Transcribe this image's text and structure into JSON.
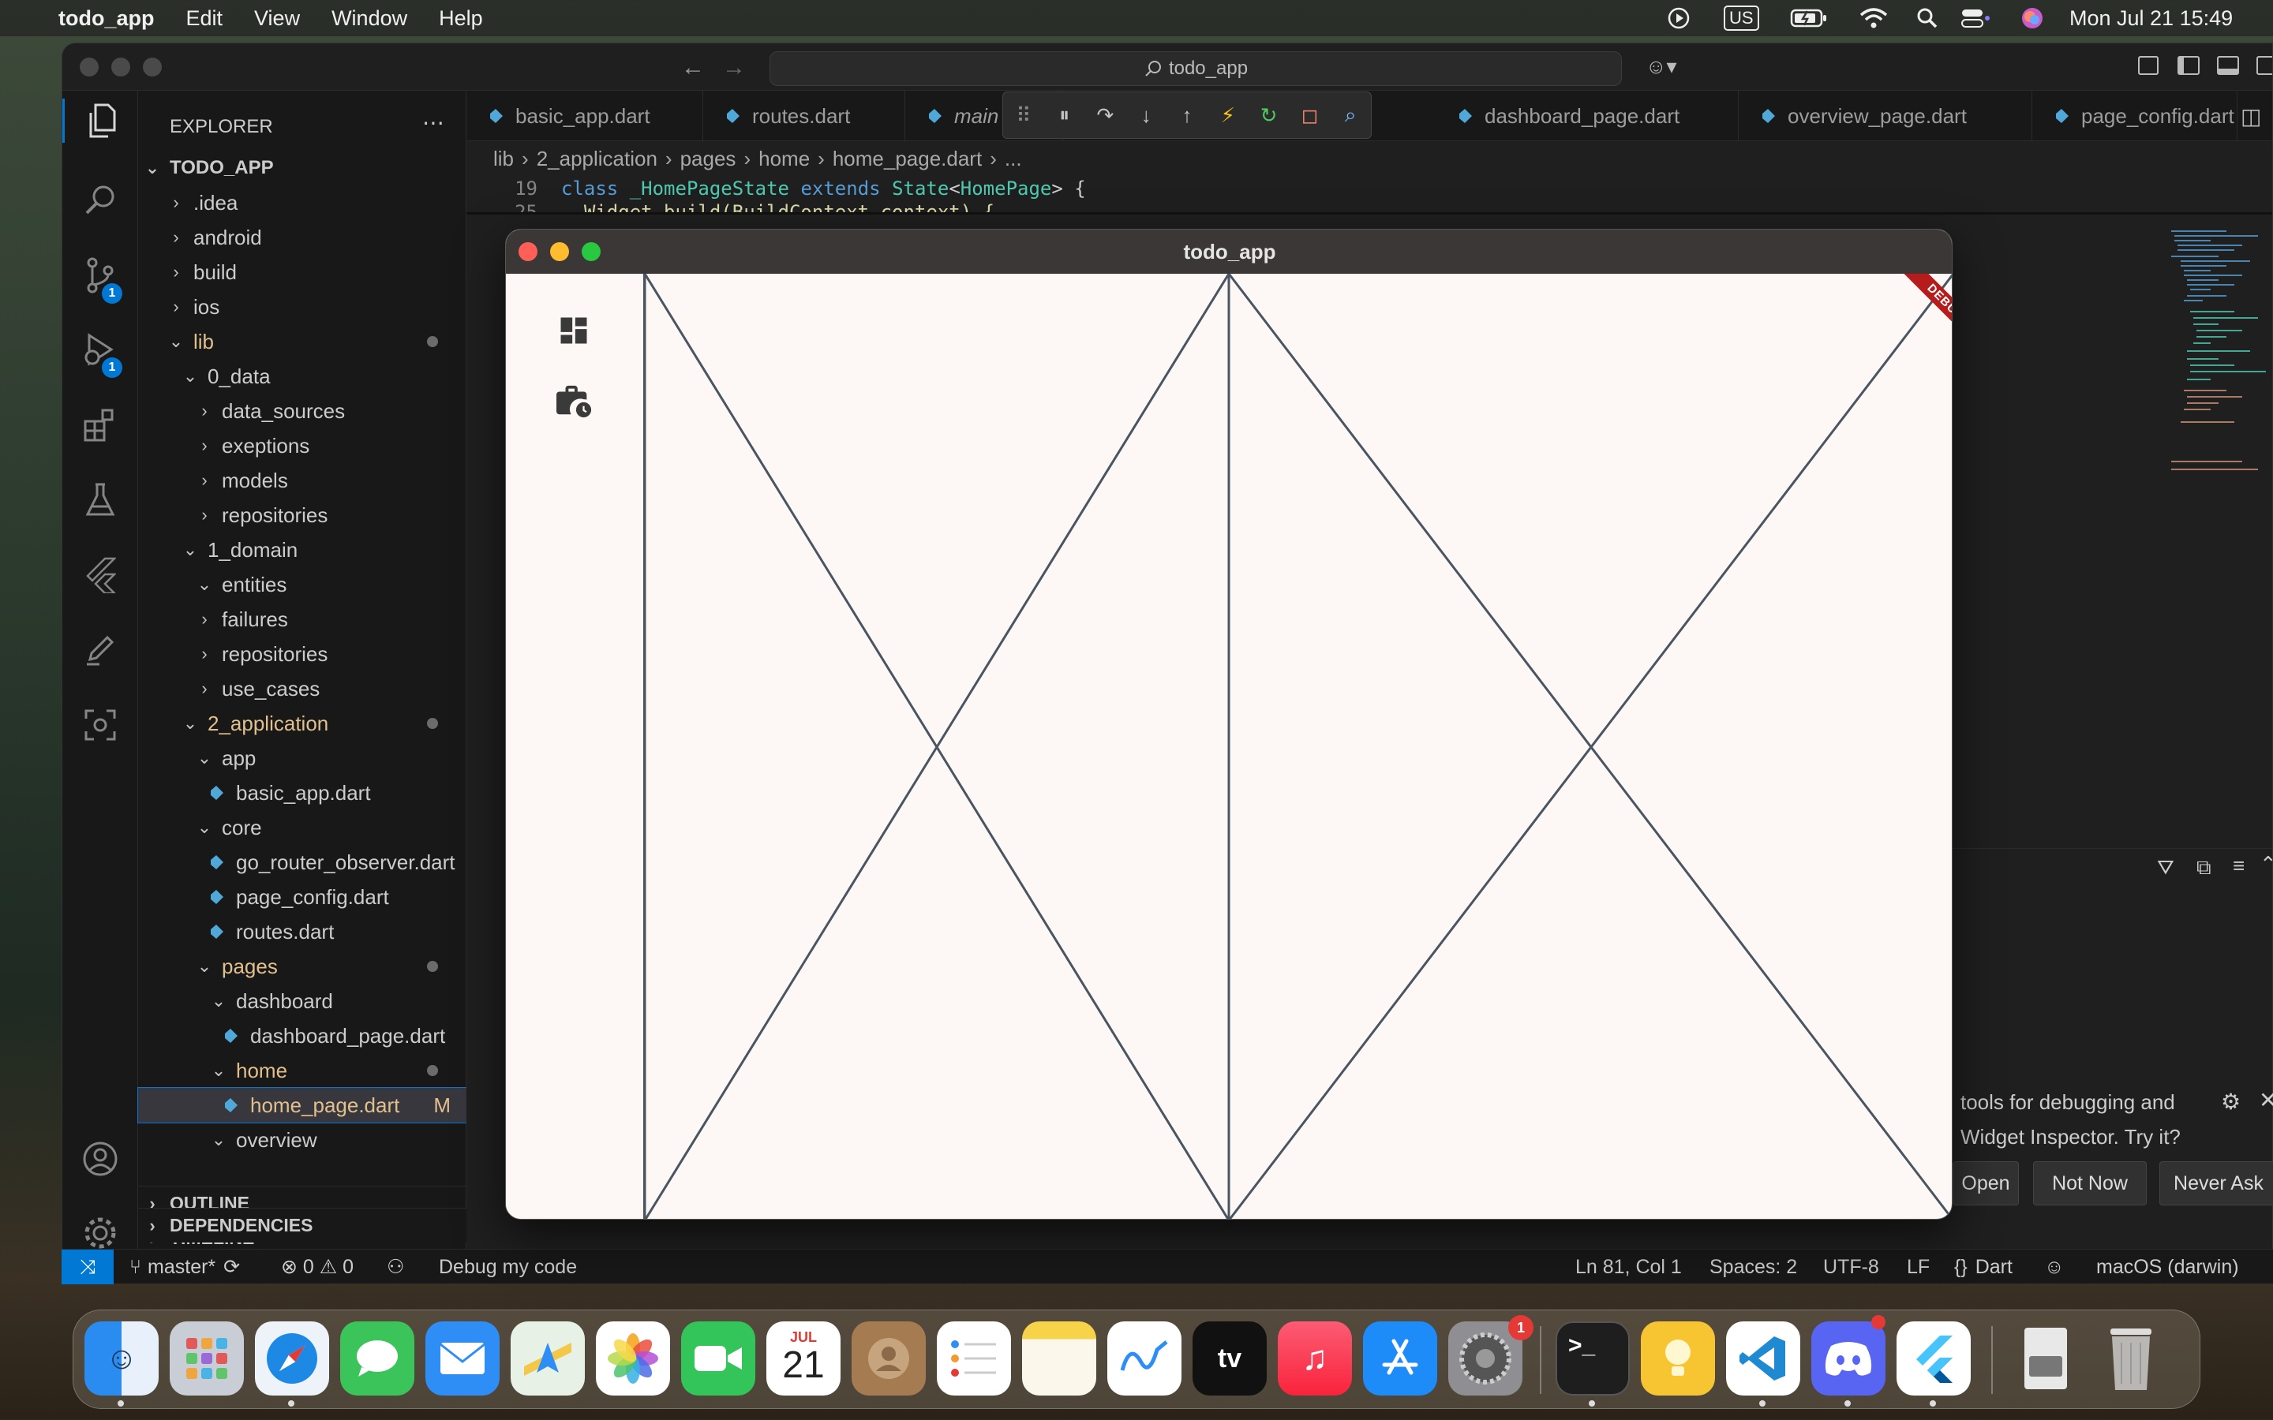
{
  "menubar": {
    "app_name": "todo_app",
    "menus": [
      "Edit",
      "View",
      "Window",
      "Help"
    ],
    "keyboard": "US",
    "clock": "Mon Jul 21  15:49"
  },
  "vscode": {
    "command_center": "todo_app",
    "explorer_title": "EXPLORER",
    "project": "TODO_APP",
    "tree": [
      {
        "label": ".idea",
        "type": "folder",
        "open": false,
        "depth": 1
      },
      {
        "label": "android",
        "type": "folder",
        "open": false,
        "depth": 1
      },
      {
        "label": "build",
        "type": "folder",
        "open": false,
        "depth": 1
      },
      {
        "label": "ios",
        "type": "folder",
        "open": false,
        "depth": 1
      },
      {
        "label": "lib",
        "type": "folder",
        "open": true,
        "depth": 1,
        "modified": true
      },
      {
        "label": "0_data",
        "type": "folder",
        "open": true,
        "depth": 2
      },
      {
        "label": "data_sources",
        "type": "folder",
        "open": false,
        "depth": 3
      },
      {
        "label": "exeptions",
        "type": "folder",
        "open": false,
        "depth": 3
      },
      {
        "label": "models",
        "type": "folder",
        "open": false,
        "depth": 3
      },
      {
        "label": "repositories",
        "type": "folder",
        "open": false,
        "depth": 3
      },
      {
        "label": "1_domain",
        "type": "folder",
        "open": true,
        "depth": 2
      },
      {
        "label": "entities",
        "type": "folder",
        "open": true,
        "depth": 3
      },
      {
        "label": "failures",
        "type": "folder",
        "open": false,
        "depth": 3
      },
      {
        "label": "repositories",
        "type": "folder",
        "open": false,
        "depth": 3
      },
      {
        "label": "use_cases",
        "type": "folder",
        "open": false,
        "depth": 3
      },
      {
        "label": "2_application",
        "type": "folder",
        "open": true,
        "depth": 2,
        "modified": true
      },
      {
        "label": "app",
        "type": "folder",
        "open": true,
        "depth": 3
      },
      {
        "label": "basic_app.dart",
        "type": "file",
        "depth": 4
      },
      {
        "label": "core",
        "type": "folder",
        "open": true,
        "depth": 3
      },
      {
        "label": "go_router_observer.dart",
        "type": "file",
        "depth": 4
      },
      {
        "label": "page_config.dart",
        "type": "file",
        "depth": 4
      },
      {
        "label": "routes.dart",
        "type": "file",
        "depth": 4
      },
      {
        "label": "pages",
        "type": "folder",
        "open": true,
        "depth": 3,
        "modified": true
      },
      {
        "label": "dashboard",
        "type": "folder",
        "open": true,
        "depth": 4
      },
      {
        "label": "dashboard_page.dart",
        "type": "file",
        "depth": 5
      },
      {
        "label": "home",
        "type": "folder",
        "open": true,
        "depth": 4,
        "modified": true
      },
      {
        "label": "home_page.dart",
        "type": "file",
        "depth": 5,
        "selected": true,
        "status": "M"
      },
      {
        "label": "overview",
        "type": "folder",
        "open": true,
        "depth": 4
      }
    ],
    "sections": [
      "OUTLINE",
      "TIMELINE",
      "DEPENDENCIES"
    ],
    "tabs": [
      "basic_app.dart",
      "routes.dart",
      "main",
      "dashboard_page.dart",
      "overview_page.dart",
      "page_config.dart"
    ],
    "breadcrumb": [
      "lib",
      "2_application",
      "pages",
      "home",
      "home_page.dart",
      "..."
    ],
    "code_lines": [
      {
        "num": "19",
        "text": "class _HomePageState extends State<HomePage> {"
      },
      {
        "num": "25",
        "text": "  Widget build(BuildContext context) {"
      }
    ],
    "notification": {
      "text1": "tools for debugging and",
      "text2": "Widget Inspector. Try it?",
      "buttons": [
        "Open",
        "Not Now",
        "Never Ask"
      ]
    },
    "status": {
      "branch": "master*",
      "errors": "0",
      "warnings": "0",
      "debug": "Debug my code",
      "position": "Ln 81, Col 1",
      "spaces": "Spaces: 2",
      "encoding": "UTF-8",
      "eol": "LF",
      "language": "Dart",
      "platform": "macOS (darwin)"
    }
  },
  "flutter_window": {
    "title": "todo_app",
    "banner": "DEBUG",
    "rail_icons": [
      "dashboard-icon",
      "work-history-icon"
    ]
  },
  "dock": {
    "calendar_month": "JUL",
    "calendar_day": "21",
    "badges": {
      "settings": "1"
    },
    "apps": [
      "Finder",
      "Launchpad",
      "Safari",
      "Messages",
      "Mail",
      "Maps",
      "Photos",
      "FaceTime",
      "Calendar",
      "Contacts",
      "Reminders",
      "Notes",
      "Freeform",
      "TV",
      "Music",
      "App Store",
      "System Settings",
      "Terminal",
      "Tips",
      "VS Code",
      "Discord",
      "Flutter",
      "Archive",
      "Trash"
    ]
  },
  "colors": {
    "accent": "#0078d4",
    "flutter_bg": "#fdf8f5",
    "placeholder_line": "#4a5562",
    "debug_banner": "#b71c1c"
  }
}
